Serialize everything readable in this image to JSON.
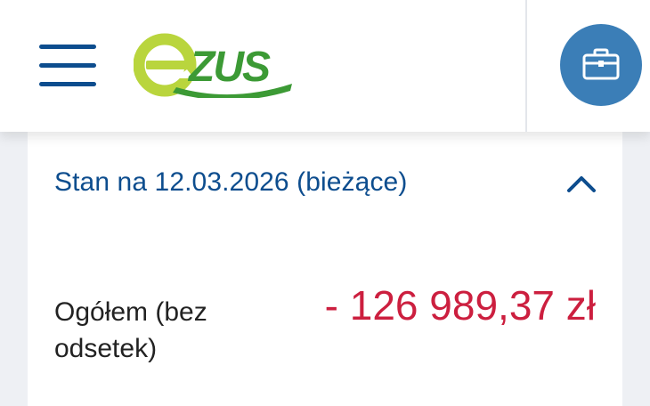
{
  "header": {
    "menu_icon": "hamburger-menu-icon",
    "logo_text": "eZUS",
    "account_icon": "briefcase-icon",
    "colors": {
      "navy": "#0d4d8e",
      "logo_lime": "#b9d53d",
      "logo_green": "#3c9a35",
      "button_blue": "#3b7eb7"
    }
  },
  "balance": {
    "title": "Stan na 12.03.2026 (bieżące)",
    "toggle_icon": "chevron-up-icon",
    "row_label": "Ogółem (bez odsetek)",
    "amount": "- 126 989,37 zł",
    "amount_color": "#cc1f3f"
  }
}
